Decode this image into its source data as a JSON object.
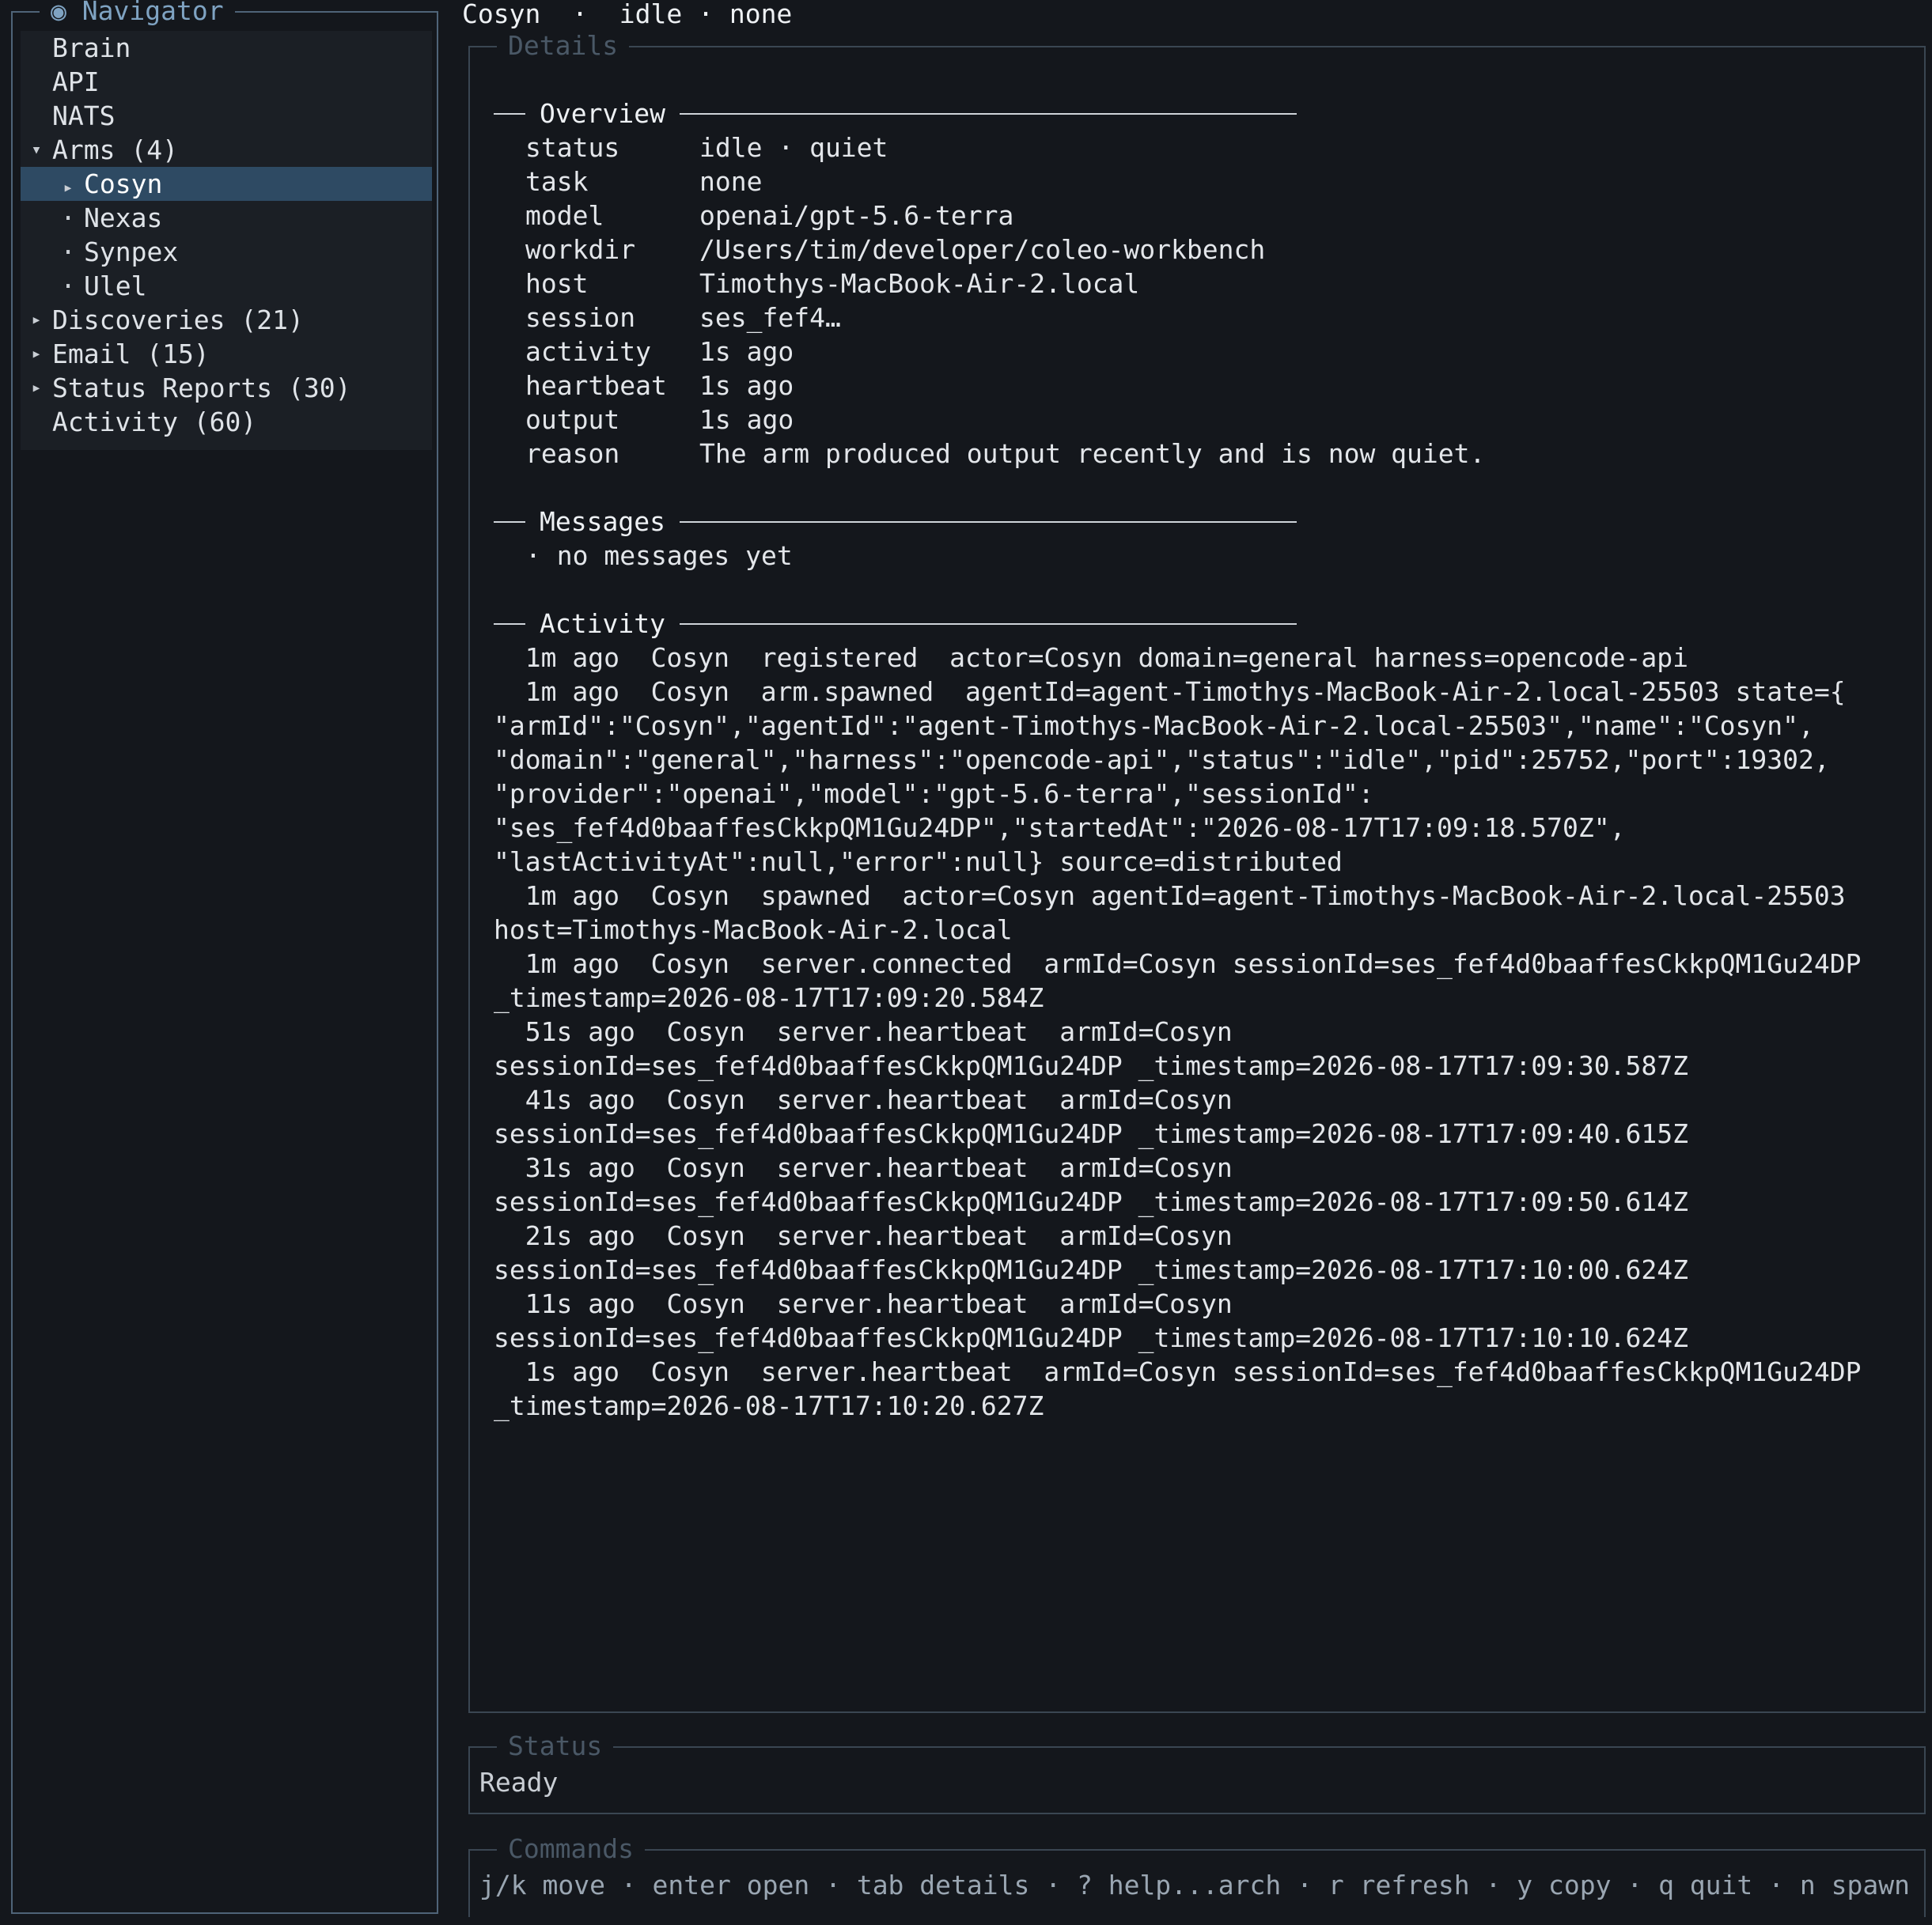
{
  "header": {
    "arm": "Cosyn",
    "state": "idle",
    "task": "none",
    "separator": "·"
  },
  "navigator": {
    "title": "Navigator",
    "title_icon": "radio-dot-icon",
    "items": [
      {
        "label": "Brain"
      },
      {
        "label": "API"
      },
      {
        "label": "NATS"
      },
      {
        "label": "Arms (4)",
        "expanded": true
      },
      {
        "label": "Cosyn",
        "selected": true
      },
      {
        "label": "Nexas"
      },
      {
        "label": "Synpex"
      },
      {
        "label": "Ulel"
      },
      {
        "label": "Discoveries (21)",
        "expanded": false
      },
      {
        "label": "Email (15)",
        "expanded": false
      },
      {
        "label": "Status Reports (30)",
        "expanded": false
      },
      {
        "label": "Activity (60)"
      }
    ]
  },
  "details": {
    "title": "Details",
    "overview": {
      "heading": "Overview",
      "rows": [
        {
          "key": "status",
          "value": "idle · quiet"
        },
        {
          "key": "task",
          "value": "none"
        },
        {
          "key": "model",
          "value": "openai/gpt-5.6-terra"
        },
        {
          "key": "workdir",
          "value": "/Users/tim/developer/coleo-workbench"
        },
        {
          "key": "host",
          "value": "Timothys-MacBook-Air-2.local"
        },
        {
          "key": "session",
          "value": "ses_fef4…"
        },
        {
          "key": "activity",
          "value": "1s ago"
        },
        {
          "key": "heartbeat",
          "value": "1s ago"
        },
        {
          "key": "output",
          "value": "1s ago"
        },
        {
          "key": "reason",
          "value": "The arm produced output recently and is now quiet."
        }
      ]
    },
    "messages": {
      "heading": "Messages",
      "empty": "· no messages yet"
    },
    "activity": {
      "heading": "Activity",
      "lines": [
        "  1m ago  Cosyn  registered  actor=Cosyn domain=general harness=opencode-api",
        "  1m ago  Cosyn  arm.spawned  agentId=agent-Timothys-MacBook-Air-2.local-25503 state={",
        "\"armId\":\"Cosyn\",\"agentId\":\"agent-Timothys-MacBook-Air-2.local-25503\",\"name\":\"Cosyn\",",
        "\"domain\":\"general\",\"harness\":\"opencode-api\",\"status\":\"idle\",\"pid\":25752,\"port\":19302,",
        "\"provider\":\"openai\",\"model\":\"gpt-5.6-terra\",\"sessionId\":",
        "\"ses_fef4d0baaffesCkkpQM1Gu24DP\",\"startedAt\":\"2026-08-17T17:09:18.570Z\",",
        "\"lastActivityAt\":null,\"error\":null} source=distributed",
        "  1m ago  Cosyn  spawned  actor=Cosyn agentId=agent-Timothys-MacBook-Air-2.local-25503",
        "host=Timothys-MacBook-Air-2.local",
        "  1m ago  Cosyn  server.connected  armId=Cosyn sessionId=ses_fef4d0baaffesCkkpQM1Gu24DP",
        "_timestamp=2026-08-17T17:09:20.584Z",
        "  51s ago  Cosyn  server.heartbeat  armId=Cosyn",
        "sessionId=ses_fef4d0baaffesCkkpQM1Gu24DP _timestamp=2026-08-17T17:09:30.587Z",
        "  41s ago  Cosyn  server.heartbeat  armId=Cosyn",
        "sessionId=ses_fef4d0baaffesCkkpQM1Gu24DP _timestamp=2026-08-17T17:09:40.615Z",
        "  31s ago  Cosyn  server.heartbeat  armId=Cosyn",
        "sessionId=ses_fef4d0baaffesCkkpQM1Gu24DP _timestamp=2026-08-17T17:09:50.614Z",
        "  21s ago  Cosyn  server.heartbeat  armId=Cosyn",
        "sessionId=ses_fef4d0baaffesCkkpQM1Gu24DP _timestamp=2026-08-17T17:10:00.624Z",
        "  11s ago  Cosyn  server.heartbeat  armId=Cosyn",
        "sessionId=ses_fef4d0baaffesCkkpQM1Gu24DP _timestamp=2026-08-17T17:10:10.624Z",
        "  1s ago  Cosyn  server.heartbeat  armId=Cosyn sessionId=ses_fef4d0baaffesCkkpQM1Gu24DP",
        "_timestamp=2026-08-17T17:10:20.627Z"
      ]
    }
  },
  "status": {
    "title": "Status",
    "text": "Ready"
  },
  "commands": {
    "title": "Commands",
    "text": "j/k move · enter open · tab details · ? help...arch · r refresh · y copy · q quit · n spawn"
  },
  "colors": {
    "background": "#14171c",
    "panel_border": "#4f6478",
    "selected_row": "#2e4a63",
    "legend_dim": "#4a5866",
    "legend_accent": "#7fa3c2"
  }
}
